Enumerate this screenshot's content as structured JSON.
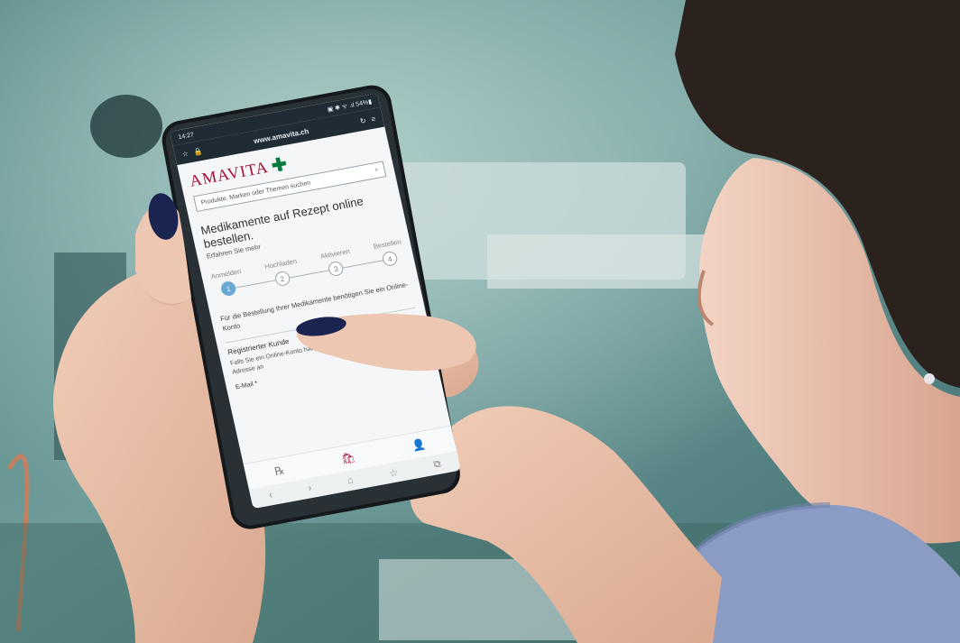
{
  "phone": {
    "status": {
      "time": "14:27",
      "indicators": "▣ ✱ ᯤ .ıl 54%▮"
    },
    "browser": {
      "url": "www.amavita.ch",
      "star_icon": "star-icon",
      "lock_icon": "lock-icon",
      "menu_icon": "menu-icon",
      "reload_icon": "reload-icon"
    },
    "logo": {
      "text": "AMAVITA",
      "symbol": "✚"
    },
    "search": {
      "placeholder": "Produkte, Marken oder Themen suchen"
    },
    "hero": {
      "title": "Medikamente auf Rezept online bestellen.",
      "link": "Erfahren Sie mehr"
    },
    "steps": [
      {
        "label": "Anmelden",
        "number": "1",
        "active": true
      },
      {
        "label": "Hochladen",
        "number": "2",
        "active": false
      },
      {
        "label": "Aktivieren",
        "number": "3",
        "active": false
      },
      {
        "label": "Bestellen",
        "number": "4",
        "active": false
      }
    ],
    "info_text": "Für die Bestellung Ihrer Medikamente benötigen Sie ein Online-Konto",
    "registered": {
      "heading": "Registrierter Kunde",
      "note": "Falls Sie ein Online-Konto haben, melden Sie sich mit Ihrer E-Mail- Adresse an",
      "email_label": "E-Mail *"
    },
    "nav": {
      "prescription": "℞",
      "back": "‹",
      "forward": "›",
      "home": "⌂",
      "favorite": "☆",
      "tabs": "⧉",
      "bag": "🛍",
      "account": "👤"
    }
  },
  "colors": {
    "brand_red": "#a3123b",
    "brand_green": "#0a7b3e",
    "step_active": "#6aa7d2",
    "browser_bar": "#1f2c33",
    "nail": "#1b2450",
    "sleeve": "#8a9cc4"
  }
}
